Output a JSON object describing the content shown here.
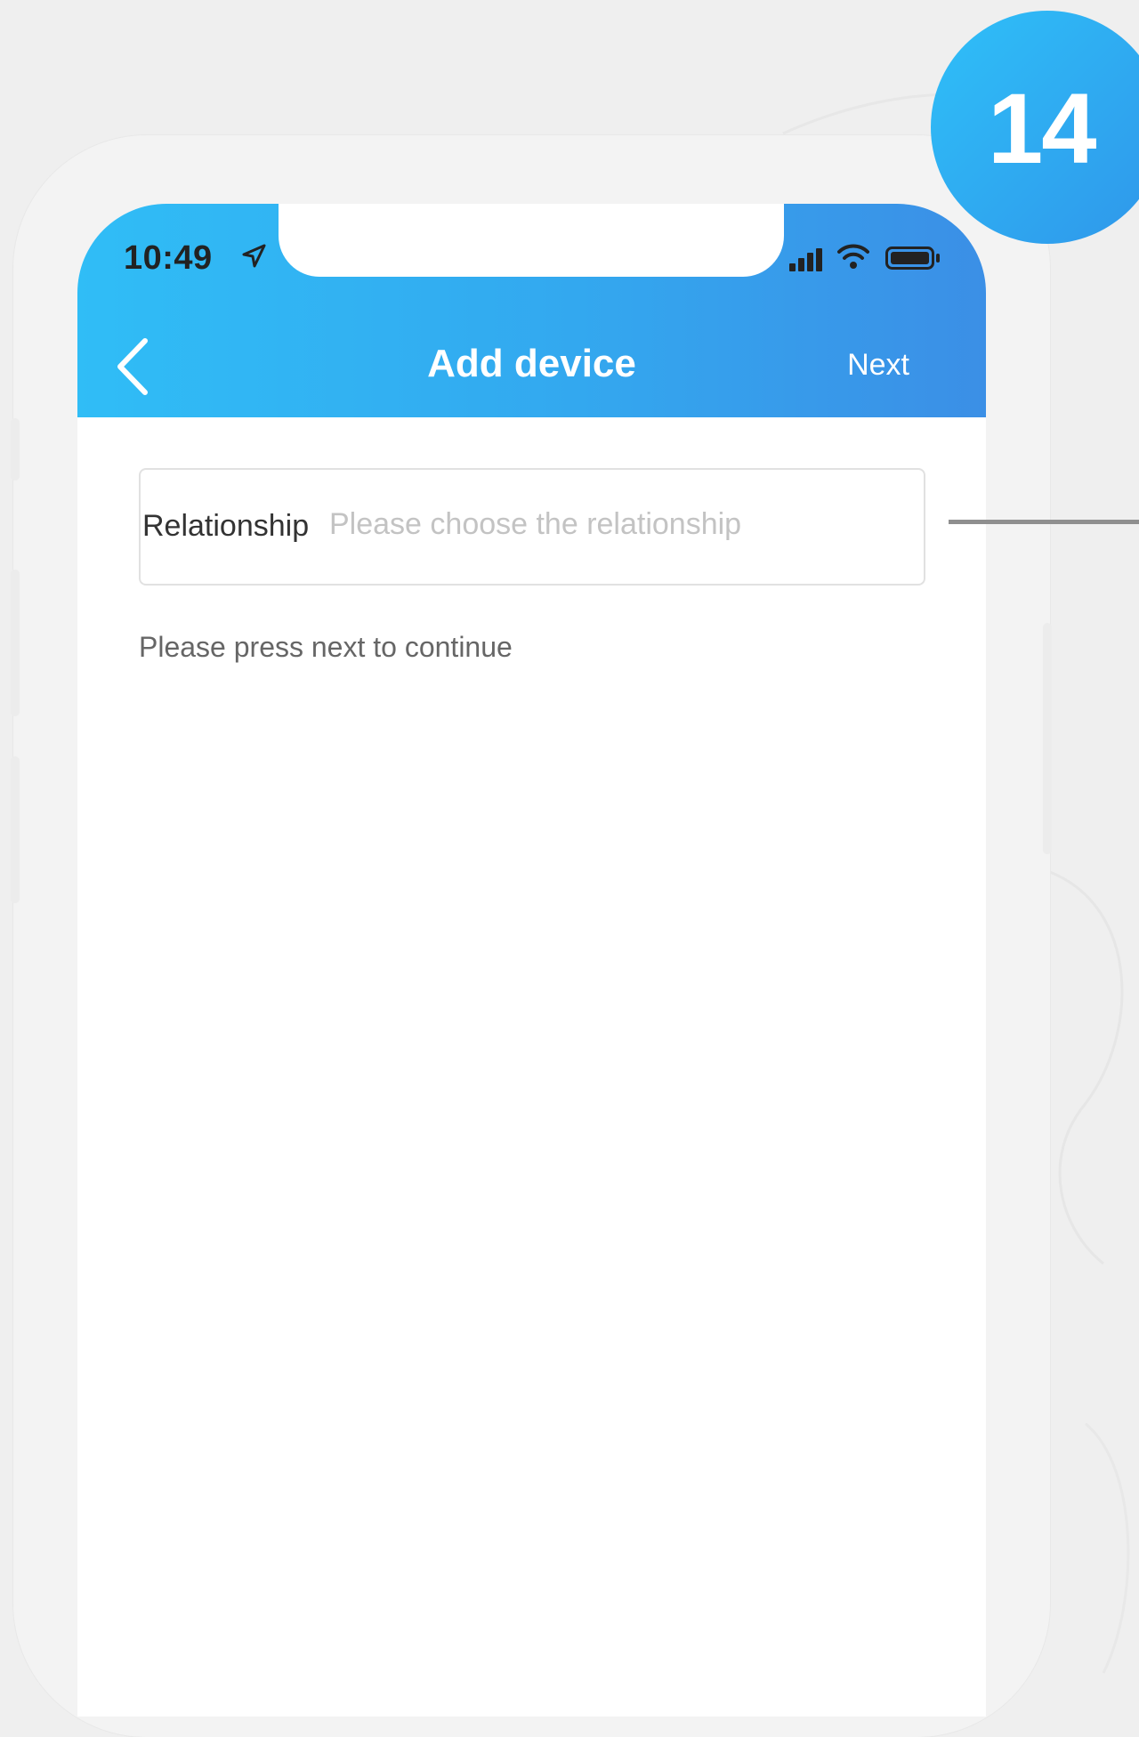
{
  "status_bar": {
    "time": "10:49",
    "icons": [
      "location-arrow-icon",
      "signal-icon",
      "wifi-icon",
      "battery-icon"
    ]
  },
  "header": {
    "title": "Add device",
    "back_icon": "chevron-left-icon",
    "next_label": "Next"
  },
  "relationship": {
    "label": "Relationship",
    "placeholder": "Please choose the relationship",
    "value": ""
  },
  "hint": "Please press next to continue",
  "step_badge": {
    "number": "14"
  },
  "colors": {
    "header_start": "#30bdf6",
    "header_end": "#3b8fe6",
    "badge": "#2fa9f0",
    "placeholder": "#c3c3c3"
  }
}
